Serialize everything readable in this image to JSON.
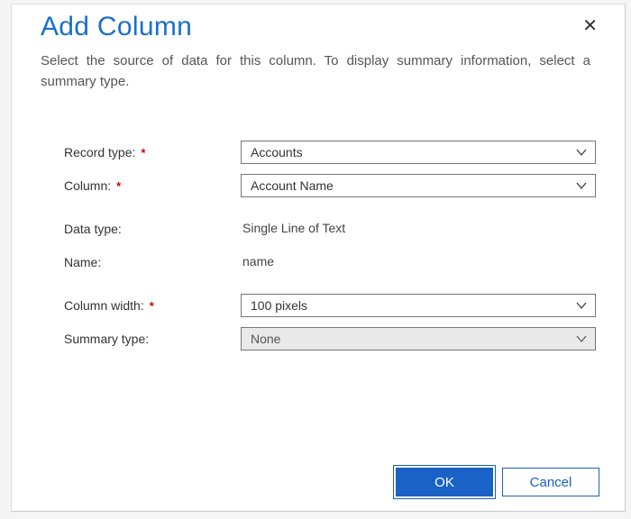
{
  "dialog": {
    "title": "Add Column",
    "subtitle": "Select the source of data for this column. To display summary information, select a summary type."
  },
  "fields": {
    "record_type": {
      "label": "Record type:",
      "value": "Accounts",
      "required": true
    },
    "column": {
      "label": "Column:",
      "value": "Account Name",
      "required": true
    },
    "data_type": {
      "label": "Data type:",
      "value": "Single Line of Text"
    },
    "name": {
      "label": "Name:",
      "value": "name"
    },
    "column_width": {
      "label": "Column width:",
      "value": "100 pixels",
      "required": true
    },
    "summary_type": {
      "label": "Summary type:",
      "value": "None"
    }
  },
  "buttons": {
    "ok": "OK",
    "cancel": "Cancel"
  },
  "required_marker": "*"
}
